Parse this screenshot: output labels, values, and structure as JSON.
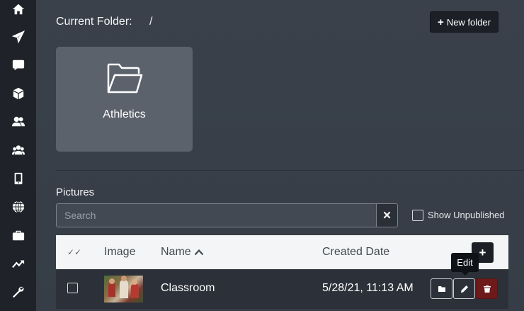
{
  "sidebar": {
    "items": [
      {
        "icon": "home-icon"
      },
      {
        "icon": "paper-plane-icon"
      },
      {
        "icon": "chat-bubble-icon"
      },
      {
        "icon": "cube-icon"
      },
      {
        "icon": "user-pair-icon"
      },
      {
        "icon": "users-group-icon"
      },
      {
        "icon": "mobile-phone-icon"
      },
      {
        "icon": "globe-icon"
      },
      {
        "icon": "briefcase-icon"
      },
      {
        "icon": "trending-up-icon"
      },
      {
        "icon": "wrench-icon"
      }
    ]
  },
  "header": {
    "current_folder_label": "Current Folder:",
    "current_folder_path": "/",
    "new_folder_label": "New folder"
  },
  "folders": [
    {
      "name": "Athletics"
    }
  ],
  "pictures": {
    "heading": "Pictures",
    "search_placeholder": "Search",
    "search_value": "",
    "clear_symbol": "✕",
    "show_unpublished_label": "Show Unpublished",
    "show_unpublished_checked": false
  },
  "table": {
    "headers": {
      "check": "✓✓",
      "image": "Image",
      "name": "Name",
      "sort_arrow": "⌃",
      "created": "Created Date",
      "add": "+"
    },
    "rows": [
      {
        "name": "Classroom",
        "created": "5/28/21, 11:13 AM"
      }
    ]
  },
  "tooltip": {
    "text": "Edit"
  },
  "colors": {
    "sidebar_bg": "#1f2329",
    "main_bg": "#363d46",
    "folder_card": "#5b626c",
    "delete_button": "#6e1a1a"
  }
}
